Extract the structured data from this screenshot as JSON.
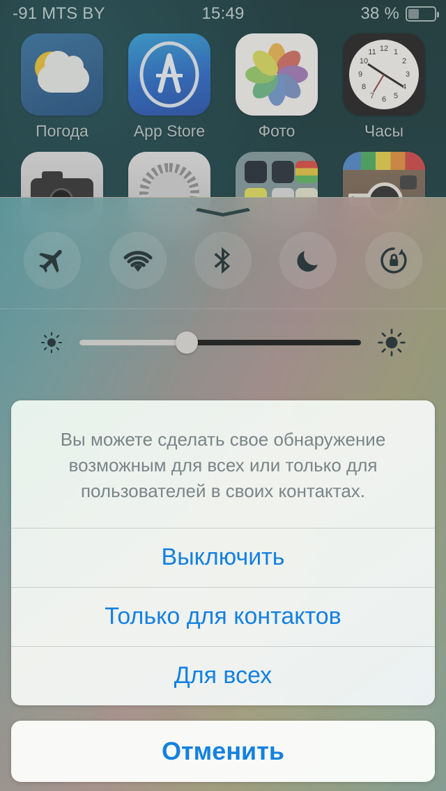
{
  "status_bar": {
    "carrier": "-91 MTS BY",
    "time": "15:49",
    "battery_percent": "38 %",
    "battery_level": 38
  },
  "home_screen": {
    "row1": [
      {
        "label": "Погода",
        "icon": "weather-icon"
      },
      {
        "label": "App Store",
        "icon": "appstore-icon"
      },
      {
        "label": "Фото",
        "icon": "photos-icon"
      },
      {
        "label": "Часы",
        "icon": "clock-icon"
      }
    ],
    "row2": [
      {
        "label": "",
        "icon": "camera-icon"
      },
      {
        "label": "",
        "icon": "settings-icon"
      },
      {
        "label": "",
        "icon": "folder-icon"
      },
      {
        "label": "",
        "icon": "instagram-icon"
      }
    ],
    "dock": [
      {
        "label": "",
        "icon": "phone-icon"
      },
      {
        "label": "",
        "icon": "safari-icon"
      },
      {
        "label": "",
        "icon": "music-icon"
      },
      {
        "label": "",
        "icon": "camera-icon"
      }
    ]
  },
  "control_center": {
    "grabber": "chevron-down-grabber",
    "toggles": [
      {
        "name": "airplane-mode",
        "icon": "airplane-icon",
        "active": false
      },
      {
        "name": "wifi",
        "icon": "wifi-icon",
        "active": false
      },
      {
        "name": "bluetooth",
        "icon": "bluetooth-icon",
        "active": false
      },
      {
        "name": "do-not-disturb",
        "icon": "moon-icon",
        "active": false
      },
      {
        "name": "rotation-lock",
        "icon": "rotation-lock-icon",
        "active": false
      }
    ],
    "brightness": {
      "value": 38,
      "low_icon": "sun-small-icon",
      "high_icon": "sun-large-icon"
    }
  },
  "action_sheet": {
    "message": "Вы можете сделать свое обнаружение возможным для всех или только для пользователей в своих контактах.",
    "options": [
      {
        "label": "Выключить"
      },
      {
        "label": "Только для контактов"
      },
      {
        "label": "Для всех"
      }
    ],
    "cancel_label": "Отменить"
  },
  "colors": {
    "accent_blue": "#1481e0",
    "message_gray": "#7a8588",
    "status_text": "#aebcbc"
  }
}
